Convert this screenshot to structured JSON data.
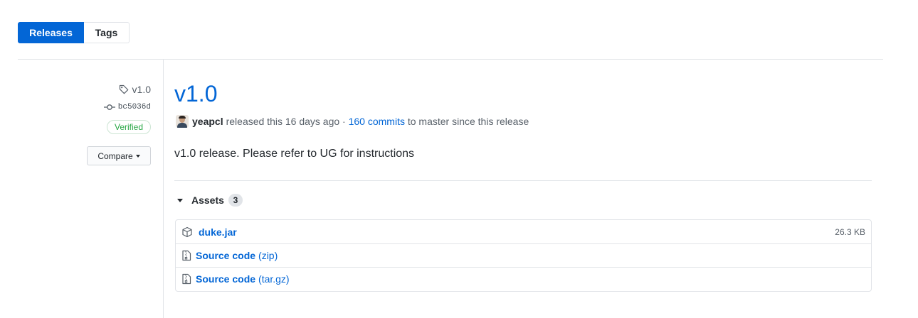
{
  "tabs": {
    "releases": "Releases",
    "tags": "Tags"
  },
  "sidebar": {
    "tag": "v1.0",
    "commit": "bc5036d",
    "verified": "Verified",
    "compare": "Compare"
  },
  "release": {
    "title": "v1.0",
    "author": "yeapcl",
    "released_text": "released this 16 days ago ·",
    "commits_link": "160 commits",
    "commits_suffix": "to master since this release",
    "description": "v1.0 release. Please refer to UG for instructions"
  },
  "assets": {
    "label": "Assets",
    "count": "3",
    "items": [
      {
        "name": "duke.jar",
        "suffix": "",
        "size": "26.3 KB",
        "icon": "package-icon"
      },
      {
        "name": "Source code",
        "suffix": "(zip)",
        "size": "",
        "icon": "file-zip-icon"
      },
      {
        "name": "Source code",
        "suffix": "(tar.gz)",
        "size": "",
        "icon": "file-zip-icon"
      }
    ]
  },
  "colors": {
    "accent": "#0366d6",
    "verified": "#28a745",
    "border": "#e1e4e8"
  }
}
